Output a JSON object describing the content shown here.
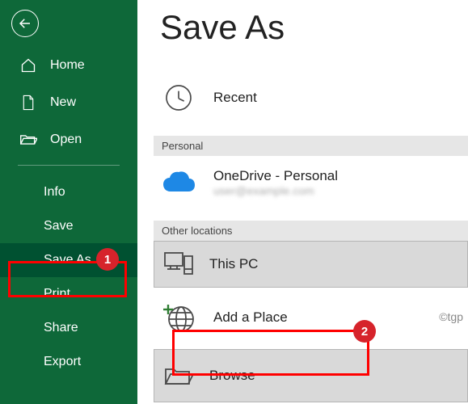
{
  "sidebar": {
    "items": [
      {
        "label": "Home"
      },
      {
        "label": "New"
      },
      {
        "label": "Open"
      }
    ],
    "sub_items": [
      {
        "label": "Info"
      },
      {
        "label": "Save"
      },
      {
        "label": "Save As"
      },
      {
        "label": "Print"
      },
      {
        "label": "Share"
      },
      {
        "label": "Export"
      }
    ]
  },
  "main": {
    "title": "Save As",
    "recent": "Recent",
    "section_personal": "Personal",
    "onedrive": {
      "title": "OneDrive - Personal",
      "subtitle": "user@example.com"
    },
    "section_other": "Other locations",
    "this_pc": "This PC",
    "add_place": "Add a Place",
    "browse": "Browse"
  },
  "annotations": {
    "badge1": "1",
    "badge2": "2",
    "watermark": "©tgp"
  }
}
